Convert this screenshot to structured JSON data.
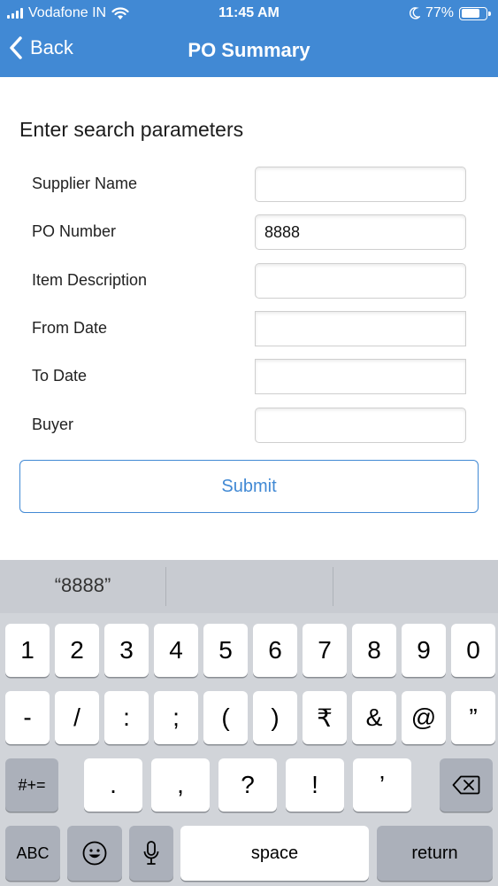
{
  "status_bar": {
    "carrier": "Vodafone IN",
    "time": "11:45 AM",
    "battery_percent": "77%",
    "battery_level": 0.77,
    "icons": [
      "signal-icon",
      "wifi-icon",
      "moon-icon",
      "battery-icon"
    ]
  },
  "nav": {
    "back_label": "Back",
    "title": "PO Summary"
  },
  "form": {
    "section_title": "Enter search parameters",
    "fields": [
      {
        "label": "Supplier Name",
        "value": ""
      },
      {
        "label": "PO Number",
        "value": "8888"
      },
      {
        "label": "Item Description",
        "value": ""
      },
      {
        "label": "From Date",
        "value": ""
      },
      {
        "label": "To Date",
        "value": ""
      },
      {
        "label": "Buyer",
        "value": ""
      }
    ],
    "submit_label": "Submit"
  },
  "keyboard": {
    "suggestion": "“8888”",
    "row1": [
      "1",
      "2",
      "3",
      "4",
      "5",
      "6",
      "7",
      "8",
      "9",
      "0"
    ],
    "row2": [
      "-",
      "/",
      ":",
      ";",
      "(",
      ")",
      "₹",
      "&",
      "@",
      "”"
    ],
    "row3": [
      ".",
      ",",
      "?",
      "!",
      "’"
    ],
    "symbols_label": "#+=",
    "abc_label": "ABC",
    "space_label": "space",
    "return_label": "return"
  },
  "colors": {
    "accent": "#4189d4",
    "keyboard_bg": "#d1d4d9",
    "key_dark": "#abb0ba"
  }
}
